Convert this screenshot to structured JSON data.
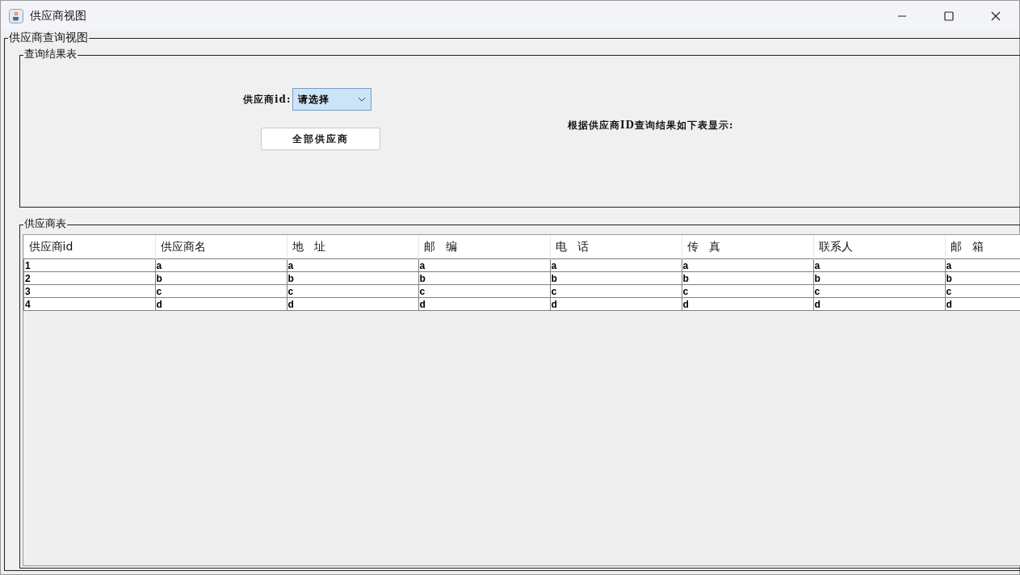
{
  "window": {
    "title": "供应商视图"
  },
  "outer_panel": {
    "title": "供应商查询视图"
  },
  "query_panel": {
    "title": "查询结果表",
    "id_label": "供应商id:",
    "id_select": {
      "value": "请选择"
    },
    "all_button": "全部供应商",
    "result_text": "根据供应商ID查询结果如下表显示:"
  },
  "table_panel": {
    "title": "供应商表"
  },
  "table": {
    "columns": [
      "供应商id",
      "供应商名",
      "地   址",
      "邮   编",
      "电   话",
      "传   真",
      "联系人",
      "邮   箱"
    ],
    "rows": [
      [
        "1",
        "a",
        "a",
        "a",
        "a",
        "a",
        "a",
        "a"
      ],
      [
        "2",
        "b",
        "b",
        "b",
        "b",
        "b",
        "b",
        "b"
      ],
      [
        "3",
        "c",
        "c",
        "c",
        "c",
        "c",
        "c",
        "c"
      ],
      [
        "4",
        "d",
        "d",
        "d",
        "d",
        "d",
        "d",
        "d"
      ]
    ]
  }
}
